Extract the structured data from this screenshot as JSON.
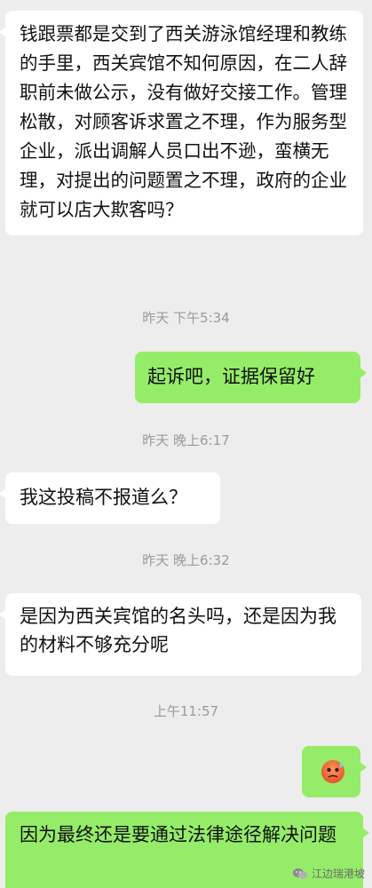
{
  "messages": [
    {
      "side": "in",
      "text": "钱跟票都是交到了西关游泳馆经理和教练的手里，西关宾馆不知何原因，在二人辞职前未做公示，没有做好交接工作。管理松散，对顾客诉求置之不理，作为服务型企业，派出调解人员口出不逊，蛮横无理，对提出的问题置之不理，政府的企业就可以店大欺客吗？"
    },
    {
      "side": "out",
      "text": "起诉吧，证据保留好"
    },
    {
      "side": "in",
      "text": "我这投稿不报道么？"
    },
    {
      "side": "in",
      "text": "是因为西关宾馆的名头吗，还是因为我的材料不够充分呢"
    },
    {
      "side": "out",
      "emoji": "sweat-face-emoji"
    },
    {
      "side": "out",
      "text": "因为最终还是要通过法律途径解决问题"
    }
  ],
  "timestamps": [
    "昨天 下午5:34",
    "昨天 晚上6:17",
    "昨天 晚上6:32",
    "上午11:57"
  ],
  "watermark": {
    "text": "江边瑞港坡",
    "icon": "wechat-icon"
  },
  "colors": {
    "background": "#ededed",
    "incoming": "#ffffff",
    "outgoing": "#95ec69",
    "timestamp": "#9a9a9a"
  }
}
